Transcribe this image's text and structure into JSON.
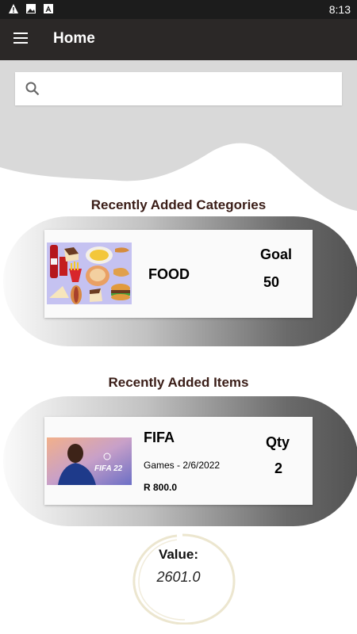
{
  "status_bar": {
    "time": "8:13",
    "icons": [
      "warning-icon",
      "image-icon",
      "app-store-icon"
    ]
  },
  "app_bar": {
    "title": "Home",
    "menu_icon": "menu-icon"
  },
  "search": {
    "value": "",
    "placeholder": "",
    "icon": "search-icon"
  },
  "categories_section": {
    "title": "Recently Added Categories",
    "card": {
      "name": "FOOD",
      "goal_label": "Goal",
      "goal_value": "50",
      "image": "food-collage-image"
    }
  },
  "items_section": {
    "title": "Recently Added Items",
    "card": {
      "name": "FIFA",
      "meta": "Games - 2/6/2022",
      "price": "R 800.0",
      "qty_label": "Qty",
      "qty_value": "2",
      "image": "fifa-22-cover-image",
      "image_text": "FIFA 22"
    }
  },
  "value_summary": {
    "label": "Value:",
    "value": "2601.0"
  },
  "colors": {
    "app_bar": "#2b2827",
    "status_bar": "#1c1c1c",
    "title_text": "#3a1d17",
    "wave": "#d9d9d9"
  }
}
